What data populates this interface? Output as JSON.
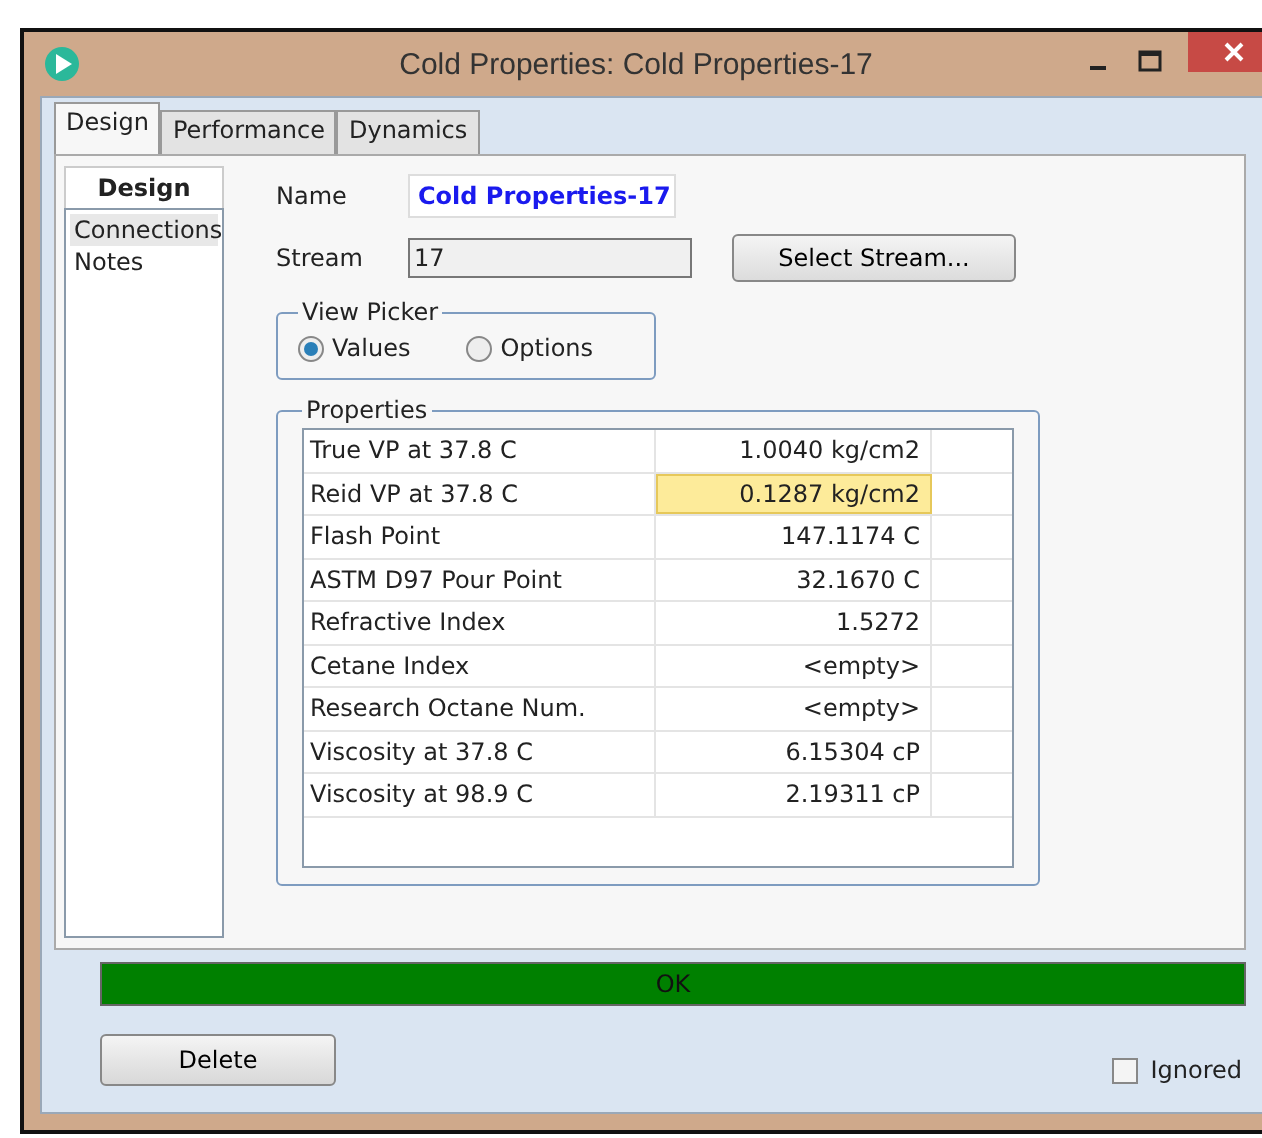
{
  "window": {
    "title": "Cold Properties: Cold Properties-17"
  },
  "tabs": [
    {
      "label": "Design",
      "selected": true
    },
    {
      "label": "Performance",
      "selected": false
    },
    {
      "label": "Dynamics",
      "selected": false
    }
  ],
  "sidebar": {
    "header": "Design",
    "items": [
      {
        "label": "Connections",
        "selected": true
      },
      {
        "label": "Notes",
        "selected": false
      }
    ]
  },
  "name_field": {
    "label": "Name",
    "value": "Cold Properties-17"
  },
  "stream_field": {
    "label": "Stream",
    "value": "17"
  },
  "select_stream_button": "Select Stream...",
  "view_picker": {
    "title": "View Picker",
    "options": [
      {
        "label": "Values",
        "selected": true
      },
      {
        "label": "Options",
        "selected": false
      }
    ]
  },
  "properties": {
    "title": "Properties",
    "rows": [
      {
        "name": "True VP at 37.8 C",
        "value": "1.0040 kg/cm2",
        "selected": false
      },
      {
        "name": "Reid VP at 37.8 C",
        "value": "0.1287 kg/cm2",
        "selected": true
      },
      {
        "name": "Flash Point",
        "value": "147.1174 C",
        "selected": false
      },
      {
        "name": "ASTM D97 Pour Point",
        "value": "32.1670 C",
        "selected": false
      },
      {
        "name": "Refractive Index",
        "value": "1.5272",
        "selected": false
      },
      {
        "name": "Cetane Index",
        "value": "<empty>",
        "selected": false
      },
      {
        "name": "Research Octane Num.",
        "value": "<empty>",
        "selected": false
      },
      {
        "name": "Viscosity at 37.8 C",
        "value": "6.15304 cP",
        "selected": false
      },
      {
        "name": "Viscosity at 98.9 C",
        "value": "2.19311 cP",
        "selected": false
      }
    ]
  },
  "status_bar": {
    "text": "OK",
    "color": "#008000"
  },
  "delete_button": "Delete",
  "ignored": {
    "label": "Ignored",
    "checked": false
  }
}
